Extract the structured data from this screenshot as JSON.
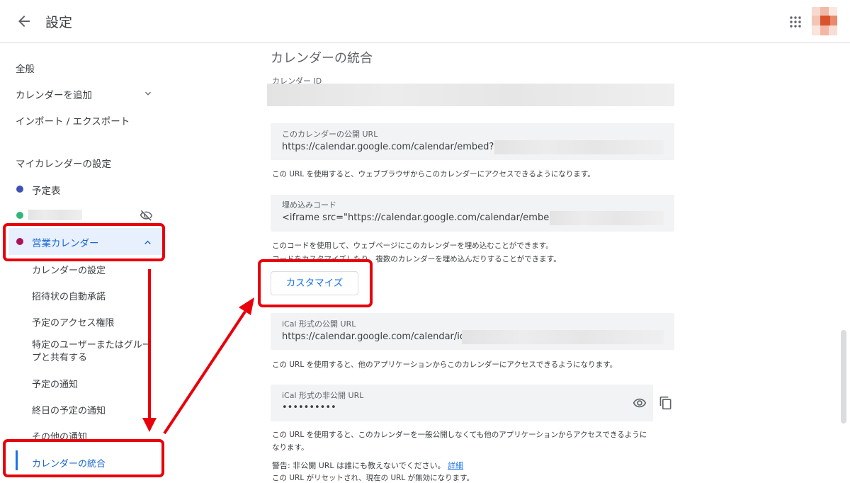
{
  "header": {
    "title": "設定"
  },
  "sidebar": {
    "general": "全般",
    "add_calendar": "カレンダーを追加",
    "import_export": "インポート / エクスポート",
    "my_calendars_heading": "マイカレンダーの設定",
    "calendars": [
      {
        "name": "予定表",
        "color": "#3f51b5"
      },
      {
        "name": "",
        "color": "#33b679"
      },
      {
        "name": "営業カレンダー",
        "color": "#ad1457"
      }
    ],
    "submenu": [
      "カレンダーの設定",
      "招待状の自動承諾",
      "予定のアクセス権限",
      "特定のユーザーまたはグループと共有する",
      "予定の通知",
      "終日の予定の通知",
      "その他の通知",
      "カレンダーの統合"
    ]
  },
  "main": {
    "section_title": "カレンダーの統合",
    "calendar_id_label": "カレンダー ID",
    "public_url_label": "このカレンダーの公開 URL",
    "public_url_value": "https://calendar.google.com/calendar/embed?src=",
    "public_url_help": "この URL を使用すると、ウェブブラウザからこのカレンダーにアクセスできるようになります。",
    "embed_label": "埋め込みコード",
    "embed_value": "<iframe src=\"https://calendar.google.com/calendar/embed?src=",
    "embed_help_1": "このコードを使用して、ウェブページにこのカレンダーを埋め込むことができます。",
    "embed_help_2": "コードをカスタマイズしたり、複数のカレンダーを埋め込んだりすることができます。",
    "customize_button": "カスタマイズ",
    "ical_public_label": "iCal 形式の公開 URL",
    "ical_public_value": "https://calendar.google.com/calendar/ical/",
    "ical_public_help": "この URL を使用すると、他のアプリケーションからこのカレンダーにアクセスできるようになります。",
    "ical_private_label": "iCal 形式の非公開 URL",
    "ical_private_value": "••••••••••",
    "ical_private_help_1": "この URL を使用すると、このカレンダーを一般公開しなくても他のアプリケーションからアクセスできるように",
    "ical_private_help_2": "なります。",
    "warning_text": "警告: 非公開 URL は誰にも教えないでください。",
    "warning_link": "詳細",
    "reset_note": "この URL がリセットされ、現在の URL が無効になります。"
  },
  "colors": {
    "accent": "#1a73e8",
    "annotation_red": "#e8000b",
    "field_bg": "#f1f3f4"
  }
}
